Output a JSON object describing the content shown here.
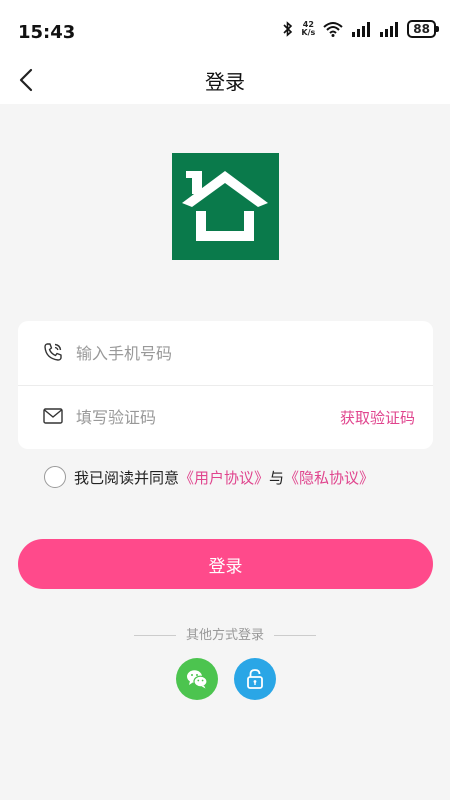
{
  "status": {
    "time": "15:43",
    "network_speed_value": "42",
    "network_speed_unit": "K/s",
    "battery": "88"
  },
  "nav": {
    "title": "登录"
  },
  "form": {
    "phone_placeholder": "输入手机号码",
    "code_placeholder": "填写验证码",
    "get_code_label": "获取验证码"
  },
  "agreement": {
    "prefix": "我已阅读并同意",
    "user_agreement": "《用户协议》",
    "conjunction": "与",
    "privacy_policy": "《隐私协议》"
  },
  "login_button": "登录",
  "other_login_label": "其他方式登录",
  "colors": {
    "accent": "#ff4a8b",
    "link": "#e0458e",
    "logo_bg": "#0a7a4b",
    "wechat": "#4cc44f",
    "lock": "#2aa6e6"
  },
  "icons": [
    "back-arrow-icon",
    "phone-icon",
    "mail-icon",
    "wechat-icon",
    "lock-icon"
  ]
}
